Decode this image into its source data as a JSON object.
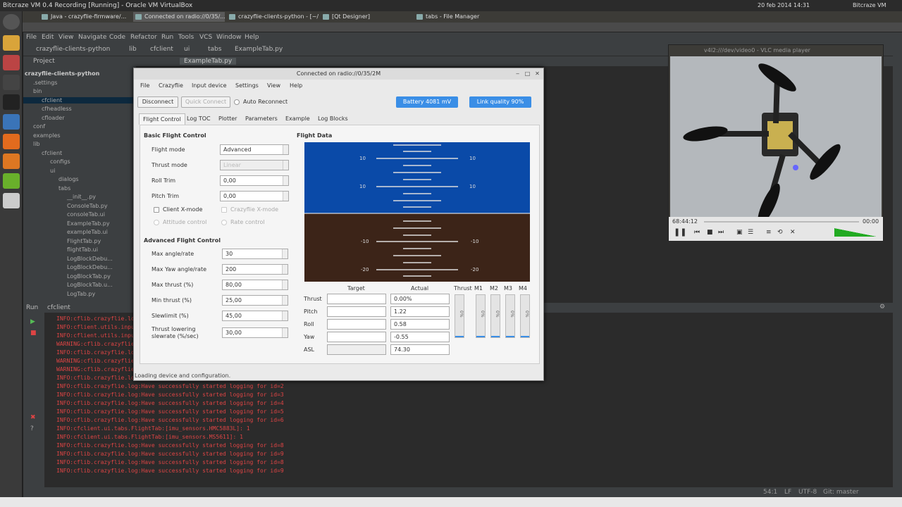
{
  "topbar": {
    "title": "Bitcraze VM 0.4 Recording [Running] - Oracle VM VirtualBox",
    "date": "20 feb 2014 14:31",
    "clock": "14:31",
    "user": "Bitcraze VM"
  },
  "taskbar": {
    "items": [
      "Java - crazyflie-firmware/...",
      "Connected on radio://0/35/...",
      "crazyflie-clients-python - [~/...",
      "[Qt Designer]",
      "tabs - File Manager"
    ]
  },
  "ide": {
    "menu": [
      "File",
      "Edit",
      "View",
      "Navigate",
      "Code",
      "Refactor",
      "Run",
      "Tools",
      "VCS",
      "Window",
      "Help"
    ],
    "breadcrumb": [
      "crazyflie-clients-python",
      "lib",
      "cfclient",
      "ui",
      "tabs",
      "ExampleTab.py"
    ],
    "tab": "ExampleTab.py",
    "project_label": "Project",
    "tree": [
      {
        "label": "crazyflie-clients-python",
        "bold": true
      },
      {
        "label": ".settings"
      },
      {
        "label": "bin"
      },
      {
        "label": "cfclient",
        "selected": true
      },
      {
        "label": "cfheadless"
      },
      {
        "label": "cfloader"
      },
      {
        "label": "conf"
      },
      {
        "label": "examples"
      },
      {
        "label": "lib"
      },
      {
        "label": "cfclient"
      },
      {
        "label": "configs"
      },
      {
        "label": "ui"
      },
      {
        "label": "dialogs"
      },
      {
        "label": "tabs"
      },
      {
        "label": "__init__.py"
      },
      {
        "label": "ConsoleTab.py"
      },
      {
        "label": "consoleTab.ui"
      },
      {
        "label": "ExampleTab.py"
      },
      {
        "label": "exampleTab.ui"
      },
      {
        "label": "FlightTab.py"
      },
      {
        "label": "flightTab.ui"
      },
      {
        "label": "LogBlockDebu..."
      },
      {
        "label": "LogBlockDebu..."
      },
      {
        "label": "LogBlockTab.py"
      },
      {
        "label": "LogBlockTab.u..."
      },
      {
        "label": "LogTab.py"
      }
    ],
    "run_label": "Run",
    "run_config": "cfclient",
    "log_lines": [
      "INFO:cflib.crazyflie.log:Have successfully started logging for id=5",
      "INFO:cflient.utils.input:...",
      "INFO:cflient.utils.input:...",
      "WARNING:cflib.crazyflie...",
      "INFO:cflib.crazyflie.log:...",
      "WARNING:cflib.crazyflie...",
      "WARNING:cflib.crazyflie...",
      "INFO:cflib.crazyflie.log:...",
      "INFO:cflib.crazyflie.log:Have successfully started logging for id=2",
      "INFO:cflib.crazyflie.log:Have successfully started logging for id=3",
      "INFO:cflib.crazyflie.log:Have successfully started logging for id=4",
      "INFO:cflib.crazyflie.log:Have successfully started logging for id=5",
      "INFO:cflib.crazyflie.log:Have successfully started logging for id=6",
      "INFO:cfclient.ui.tabs.FlightTab:[imu_sensors.HMC5883L]: 1",
      "INFO:cfclient.ui.tabs.FlightTab:[imu_sensors.MS5611]: 1",
      "INFO:cflib.crazyflie.log:Have successfully started logging for id=8",
      "INFO:cflib.crazyflie.log:Have successfully started logging for id=9",
      "INFO:cflib.crazyflie.log:Have successfully started logging for id=8",
      "INFO:cflib.crazyflie.log:Have successfully started logging for id=9"
    ],
    "status_pos": "54:1",
    "status_lf": "LF",
    "status_enc": "UTF-8",
    "status_git": "Git: master"
  },
  "dialog": {
    "title": "Connected on radio://0/35/2M",
    "menu": [
      "File",
      "Crazyflie",
      "Input device",
      "Settings",
      "View",
      "Help"
    ],
    "disconnect": "Disconnect",
    "quick_connect": "Quick Connect",
    "auto_reconnect": "Auto Reconnect",
    "battery": "Battery 4081 mV",
    "link": "Link quality 90%",
    "tabs": [
      "Flight Control",
      "Log TOC",
      "Plotter",
      "Parameters",
      "Example",
      "Log Blocks"
    ],
    "basic_title": "Basic Flight Control",
    "flight_mode_label": "Flight mode",
    "flight_mode": "Advanced",
    "thrust_mode_label": "Thrust mode",
    "thrust_mode": "Linear",
    "roll_trim_label": "Roll Trim",
    "roll_trim": "0,00",
    "pitch_trim_label": "Pitch Trim",
    "pitch_trim": "0,00",
    "client_xmode": "Client X-mode",
    "crazyflie_xmode": "Crazyflie X-mode",
    "attitude_control": "Attitude control",
    "rate_control": "Rate control",
    "advanced_title": "Advanced Flight Control",
    "max_angle_label": "Max angle/rate",
    "max_angle": "30",
    "max_yaw_label": "Max Yaw angle/rate",
    "max_yaw": "200",
    "max_thrust_label": "Max thrust (%)",
    "max_thrust": "80,00",
    "min_thrust_label": "Min thrust (%)",
    "min_thrust": "25,00",
    "slewlimit_label": "Slewlimit (%)",
    "slewlimit": "45,00",
    "thrust_lower_label": "Thrust lowering slewrate (%/sec)",
    "thrust_lower": "30,00",
    "flight_data_title": "Flight Data",
    "target_hdr": "Target",
    "actual_hdr": "Actual",
    "rows": [
      {
        "label": "Thrust",
        "target": "",
        "actual": "0.00%"
      },
      {
        "label": "Pitch",
        "target": "",
        "actual": "1.22"
      },
      {
        "label": "Roll",
        "target": "",
        "actual": "0.58"
      },
      {
        "label": "Yaw",
        "target": "",
        "actual": "-0.55"
      },
      {
        "label": "ASL",
        "target": "",
        "actual": "74.30"
      }
    ],
    "motor_hdrs": [
      "Thrust",
      "M1",
      "M2",
      "M3",
      "M4"
    ],
    "motor_values": [
      "0%",
      "0%",
      "0%",
      "0%",
      "0%"
    ],
    "horizon_marks": [
      "10",
      "10",
      "10",
      "10",
      "-10",
      "-10",
      "-20",
      "-20"
    ],
    "status": "Loading device and configuration."
  },
  "vlc": {
    "title": "v4l2:///dev/video0 - VLC media player",
    "time": "68:44:12",
    "end": "00:00"
  },
  "colors": {
    "sky": "#0a4aa8",
    "ground": "#3c2418",
    "accent": "#3a8ee6",
    "log": "#d44444"
  }
}
